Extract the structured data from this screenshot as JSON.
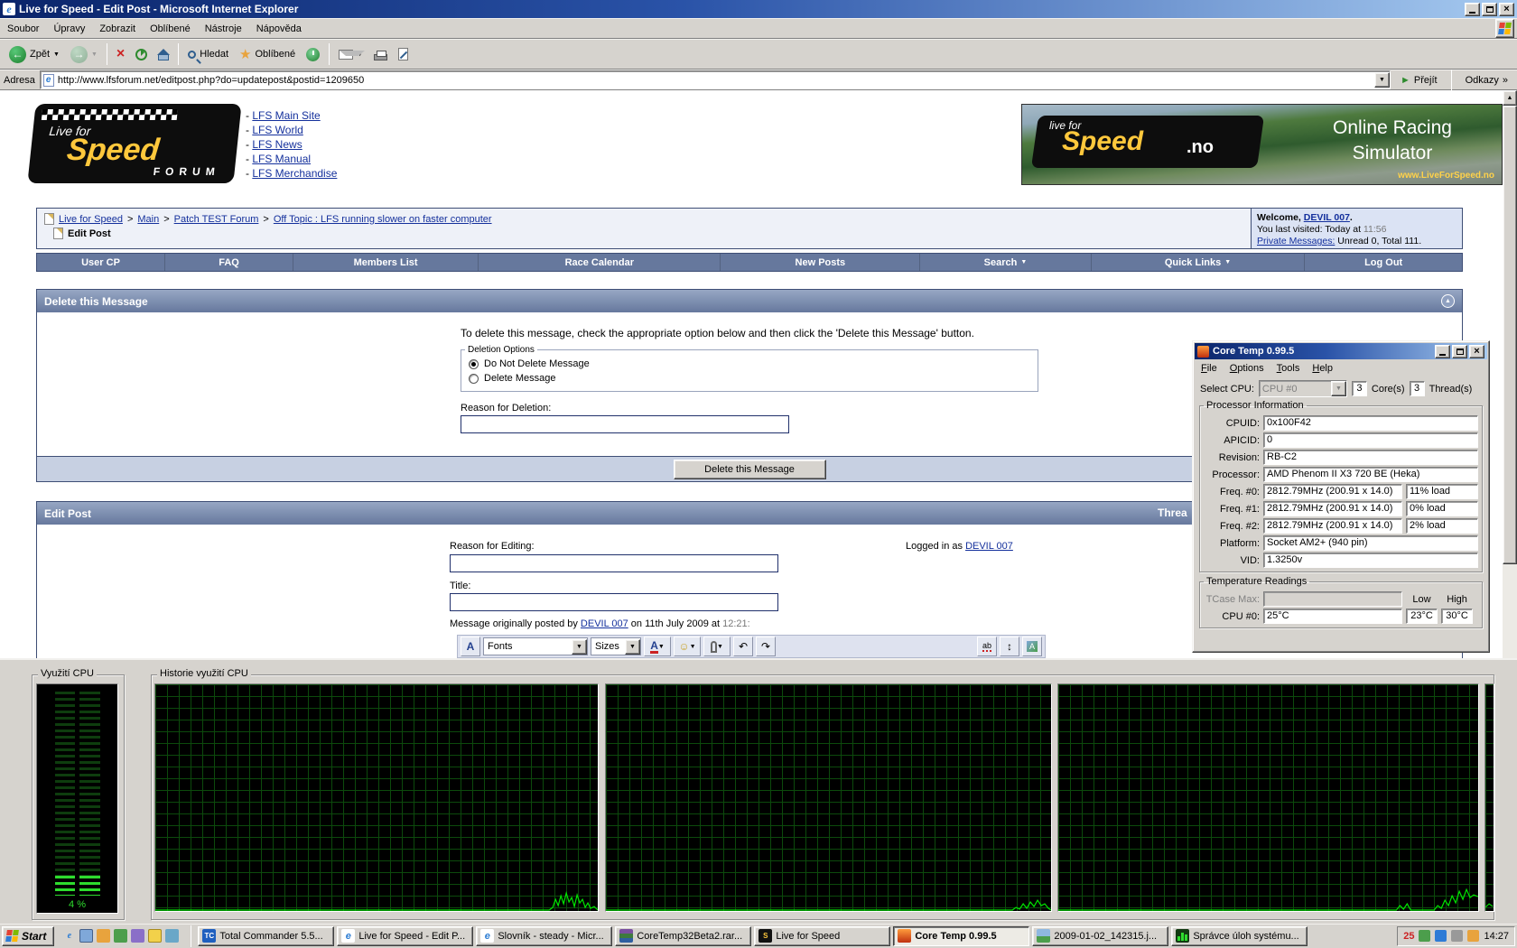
{
  "window": {
    "title": "Live for Speed - Edit Post - Microsoft Internet Explorer"
  },
  "menubar": {
    "items": [
      "Soubor",
      "Úpravy",
      "Zobrazit",
      "Oblíbené",
      "Nástroje",
      "Nápověda"
    ]
  },
  "toolbar": {
    "back": "Zpět",
    "search": "Hledat",
    "favorites": "Oblíbené"
  },
  "addressbar": {
    "label": "Adresa",
    "url": "http://www.lfsforum.net/editpost.php?do=updatepost&postid=1209650",
    "go": "Přejít",
    "links": "Odkazy"
  },
  "page": {
    "bullet": "-",
    "logo": {
      "top": "Live for",
      "main": "Speed",
      "sub": "FORUM"
    },
    "nav_links": [
      "LFS Main Site",
      "LFS World",
      "LFS News",
      "LFS Manual",
      "LFS Merchandise"
    ],
    "banner": {
      "pre": "live for",
      "brand": "Speed",
      "tld": ".no",
      "tag1": "Online Racing",
      "tag2": "Simulator",
      "site": "www.LiveForSpeed.no"
    },
    "breadcrumb": {
      "sep": ">",
      "links": [
        "Live for Speed",
        "Main",
        "Patch TEST Forum",
        "Off Topic : LFS running slower on faster computer"
      ],
      "page": "Edit Post"
    },
    "welcome": {
      "prefix": "Welcome,",
      "username": "DEVIL 007",
      "suffix": ".",
      "visited": "You last visited: Today at",
      "time": "11:56",
      "pm_label": "Private Messages:",
      "pm_value": "Unread 0, Total 111."
    },
    "navbar": {
      "items": [
        "User CP",
        "FAQ",
        "Members List",
        "Race Calendar",
        "New Posts",
        "Search",
        "Quick Links",
        "Log Out"
      ]
    },
    "del": {
      "title": "Delete this Message",
      "instruction": "To delete this message, check the appropriate option below and then click the 'Delete this Message' button.",
      "legend": "Deletion Options",
      "radio1": "Do Not Delete Message",
      "radio2": "Delete Message",
      "reason": "Reason for Deletion:",
      "button": "Delete this Message"
    },
    "edit": {
      "title": "Edit Post",
      "right": "Threa",
      "reason": "Reason for Editing:",
      "logged": "Logged in as",
      "username": "DEVIL 007",
      "title_label": "Title:",
      "msg_pre": "Message originally posted by",
      "msg_user": "DEVIL 007",
      "msg_mid": "on 11th July 2009 at",
      "msg_time": "12:21:",
      "fonts": "Fonts",
      "sizes": "Sizes"
    }
  },
  "coretemp": {
    "title": "Core Temp 0.99.5",
    "menu": [
      "File",
      "Options",
      "Tools",
      "Help"
    ],
    "select_label": "Select CPU:",
    "cpu_value": "CPU #0",
    "cores_count": "3",
    "cores_label": "Core(s)",
    "threads_count": "3",
    "threads_label": "Thread(s)",
    "info": {
      "legend": "Processor Information",
      "rows": [
        {
          "label": "CPUID:",
          "value": "0x100F42"
        },
        {
          "label": "APICID:",
          "value": "0"
        },
        {
          "label": "Revision:",
          "value": "RB-C2"
        },
        {
          "label": "Processor:",
          "value": "AMD Phenom II X3 720 BE (Heka)"
        },
        {
          "label": "Freq. #0:",
          "value": "2812.79MHz (200.91 x 14.0)",
          "load": "11% load"
        },
        {
          "label": "Freq. #1:",
          "value": "2812.79MHz (200.91 x 14.0)",
          "load": "0% load"
        },
        {
          "label": "Freq. #2:",
          "value": "2812.79MHz (200.91 x 14.0)",
          "load": "2% load"
        },
        {
          "label": "Platform:",
          "value": "Socket AM2+ (940 pin)"
        },
        {
          "label": "VID:",
          "value": "1.3250v"
        }
      ]
    },
    "temps": {
      "legend": "Temperature Readings",
      "tcase": "TCase Max:",
      "low": "Low",
      "high": "High",
      "cpu_label": "CPU #0:",
      "temp": "25°C",
      "low_v": "23°C",
      "high_v": "30°C"
    }
  },
  "taskmgr": {
    "usage_label": "Využití CPU",
    "usage_value": "4 %",
    "history_label": "Historie využití CPU"
  },
  "taskbar": {
    "start": "Start",
    "buttons": [
      {
        "label": "Total Commander 5.5..."
      },
      {
        "label": "Live for Speed - Edit P..."
      },
      {
        "label": "Slovník - steady - Micr..."
      },
      {
        "label": "CoreTemp32Beta2.rar..."
      },
      {
        "label": "Live for Speed"
      },
      {
        "label": "Core Temp 0.99.5"
      },
      {
        "label": "2009-01-02_142315.j..."
      },
      {
        "label": "Správce úloh systému..."
      }
    ],
    "tray_temp": "25",
    "clock": "14:27"
  }
}
